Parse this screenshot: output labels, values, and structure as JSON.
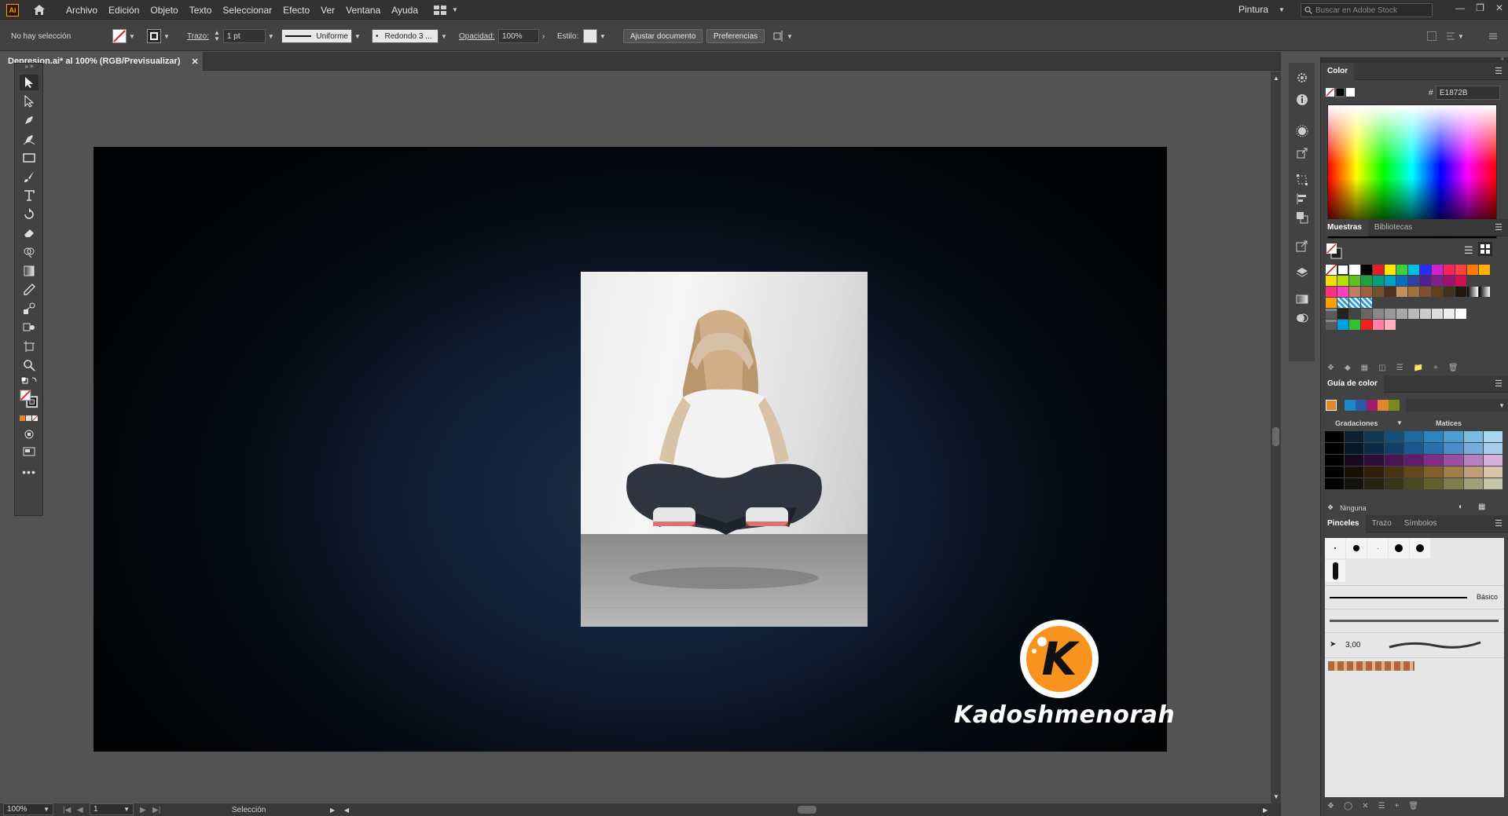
{
  "menubar": {
    "app_logo": "Ai",
    "items": [
      "Archivo",
      "Edición",
      "Objeto",
      "Texto",
      "Seleccionar",
      "Efecto",
      "Ver",
      "Ventana",
      "Ayuda"
    ],
    "workspace": "Pintura",
    "stock_search_placeholder": "Buscar en Adobe Stock"
  },
  "control_bar": {
    "selection_status": "No hay selección",
    "stroke_label": "Trazo:",
    "stroke_weight": "1 pt",
    "profile": "Uniforme",
    "brush": "Redondo 3 ...",
    "opacity_label": "Opacidad:",
    "opacity_value": "100%",
    "style_label": "Estilo:",
    "fit_document_button": "Ajustar documento",
    "preferences_button": "Preferencias"
  },
  "document": {
    "tab_title": "Depresion.ai* al 100% (RGB/Previsualizar)",
    "logo_letter": "K",
    "logo_text": "Kadoshmenorah"
  },
  "status_bar": {
    "zoom": "100%",
    "artboard": "1",
    "tool": "Selección"
  },
  "color_panel": {
    "title": "Color",
    "hex_label": "#",
    "hex_value": "E1872B"
  },
  "swatches_panel": {
    "tab_active": "Muestras",
    "tab_other": "Bibliotecas"
  },
  "color_guide_panel": {
    "title": "Guía de color",
    "gradations_label": "Gradaciones",
    "tints_label": "Matices",
    "harmony": "Ninguna"
  },
  "brushes_panel": {
    "tab_active": "Pinceles",
    "tab_stroke": "Trazo",
    "tab_symbols": "Símbolos",
    "basic_label": "Básico",
    "size_label": "3,00"
  },
  "colors": {
    "accent_orange": "#f7931e",
    "selected_fill": "#e1872b"
  }
}
